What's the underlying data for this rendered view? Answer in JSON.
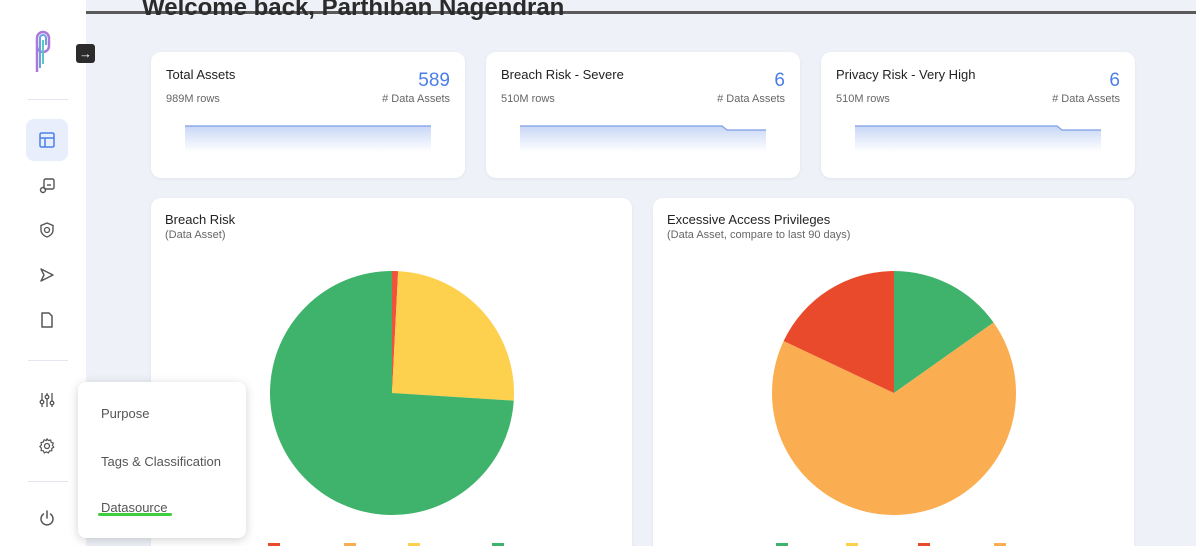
{
  "header": {
    "welcome": "Welcome back, Parthiban Nagendran"
  },
  "sidebar": {
    "expand_icon": "arrow-right",
    "items": [
      {
        "name": "table-icon",
        "active": true
      },
      {
        "name": "data-map-icon",
        "active": false
      },
      {
        "name": "shield-icon",
        "active": false
      },
      {
        "name": "send-icon",
        "active": false
      },
      {
        "name": "document-icon",
        "active": false
      },
      {
        "name": "sliders-icon",
        "active": false
      },
      {
        "name": "gear-icon",
        "active": false
      },
      {
        "name": "power-icon",
        "active": false
      }
    ]
  },
  "cards": [
    {
      "title": "Total Assets",
      "count": "589",
      "rows": "989M rows",
      "unit": "# Data Assets"
    },
    {
      "title": "Breach Risk - Severe",
      "count": "6",
      "rows": "510M rows",
      "unit": "# Data Assets"
    },
    {
      "title": "Privacy Risk - Very High",
      "count": "6",
      "rows": "510M rows",
      "unit": "# Data Assets"
    }
  ],
  "panels": [
    {
      "title": "Breach Risk",
      "subtitle": "(Data Asset)"
    },
    {
      "title": "Excessive Access Privileges",
      "subtitle": "(Data Asset, compare to last 90 days)"
    }
  ],
  "colors": {
    "green": "#3fb36b",
    "yellow": "#fdd04e",
    "orange": "#fbad52",
    "red": "#e94a2b",
    "accent": "#4a7ee8"
  },
  "chart_data": [
    {
      "type": "pie",
      "title": "Breach Risk",
      "subtitle": "(Data Asset)",
      "slices": [
        {
          "value": 0.8,
          "color": "#f0533a"
        },
        {
          "value": 25.2,
          "color": "#fdd04e"
        },
        {
          "value": 74.0,
          "color": "#3fb36b"
        }
      ]
    },
    {
      "type": "pie",
      "title": "Excessive Access Privileges",
      "subtitle": "(Data Asset, compare to last 90 days)",
      "slices": [
        {
          "value": 15.2,
          "color": "#3fb36b"
        },
        {
          "value": 66.8,
          "color": "#fbad52"
        },
        {
          "value": 18.0,
          "color": "#e94a2b"
        }
      ]
    }
  ],
  "menu": {
    "items": [
      "Purpose",
      "Tags & Classification",
      "Datasource"
    ]
  }
}
